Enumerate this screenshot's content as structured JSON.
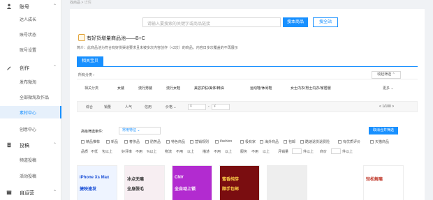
{
  "sidebar": {
    "groups": [
      {
        "label": "账号",
        "items": [
          "达人成长",
          "账号状态",
          "账号设置"
        ]
      },
      {
        "label": "创作",
        "items": [
          "发布微淘",
          "全部微淘及作品",
          "素材中心",
          "创意中心"
        ]
      },
      {
        "label": "投稿",
        "items": [
          "频道投稿",
          "活动投稿"
        ]
      },
      {
        "label": "自运营",
        "items": []
      }
    ],
    "active_item": "素材中心"
  },
  "breadcrumb": {
    "parent": "找商品",
    "sep": ">",
    "current": "详情"
  },
  "search": {
    "placeholder": "请输入要搜索的关键字或商品链接",
    "button": "搜本商品",
    "station_button": "搜全站"
  },
  "product_header": {
    "title": "有好货增量商品池——B+C",
    "description": "简介：此商品池为符合有好货渠道要求且未被多次内容创作（<3次）的商品。内容日多次覆盖的不再展示"
  },
  "tab": {
    "label": "相关宝贝"
  },
  "category_bar": {
    "all": "所有分类",
    "collapse": "收起筛选"
  },
  "categories": {
    "label": "相关分类",
    "items": [
      "女装",
      "流行男装",
      "流行女鞋",
      "美容护肤/美体/精油",
      "运动鞋/休闲鞋",
      "女士内衣/男士内衣/家居服"
    ],
    "more": "更多"
  },
  "sort": {
    "items": [
      "综合",
      "销量",
      "人气",
      "信用",
      "价格"
    ],
    "price_from": "¥",
    "price_to": "¥",
    "price_sep": "-",
    "page": "1/100"
  },
  "advanced": {
    "label": "高级筛选条件:",
    "dropdown": "常用特征",
    "cancel": "取消合并筛选"
  },
  "checkboxes": [
    "精品推荐",
    "新品",
    "奢侈品",
    "肋势品",
    "特色商品",
    "营销规则",
    "ifashion",
    "极有家",
    "海外商品",
    "包邮",
    "酷速退货退费险",
    "有优质评价",
    "天猫商品"
  ],
  "number_filters": [
    {
      "label": "品质",
      "mid": "不低",
      "unit": "包以上"
    },
    {
      "label": "好评率",
      "mid": "不用",
      "unit": "%以上"
    },
    {
      "label": "物流",
      "mid": "不用",
      "unit": "以上"
    },
    {
      "label": "描述",
      "mid": "不用",
      "unit": "以上"
    },
    {
      "label": "服务",
      "mid": "不用",
      "unit": "以上"
    },
    {
      "label": "月销量",
      "mid": "",
      "unit": "件以上"
    },
    {
      "label": "商价",
      "mid": "",
      "unit": "件以上"
    }
  ],
  "thumbs": [
    {
      "line1": "iPhone Xs Max",
      "line2": "捷映速发",
      "bg": "#eef4ff",
      "color": "#1a4fd6"
    },
    {
      "line1": "冰点无痛",
      "line2": "全身脱毛",
      "bg": "#f7eef2",
      "color": "#333"
    },
    {
      "line1": "CNV",
      "line2": "全自动上锁",
      "bg": "#b22bd0",
      "color": "#ffffff"
    },
    {
      "line1": "蜜香纯芽",
      "line2": "顺手包邮",
      "bg": "#7a0d10",
      "color": "#ffd24a"
    },
    {
      "line1": "",
      "line2": "",
      "bg": "#eeeeee",
      "color": "#333"
    },
    {
      "line1": "轻松解痛",
      "line2": "",
      "bg": "#ffffff",
      "color": "#c0392b"
    }
  ],
  "colors": {
    "accent": "#1890ff"
  }
}
